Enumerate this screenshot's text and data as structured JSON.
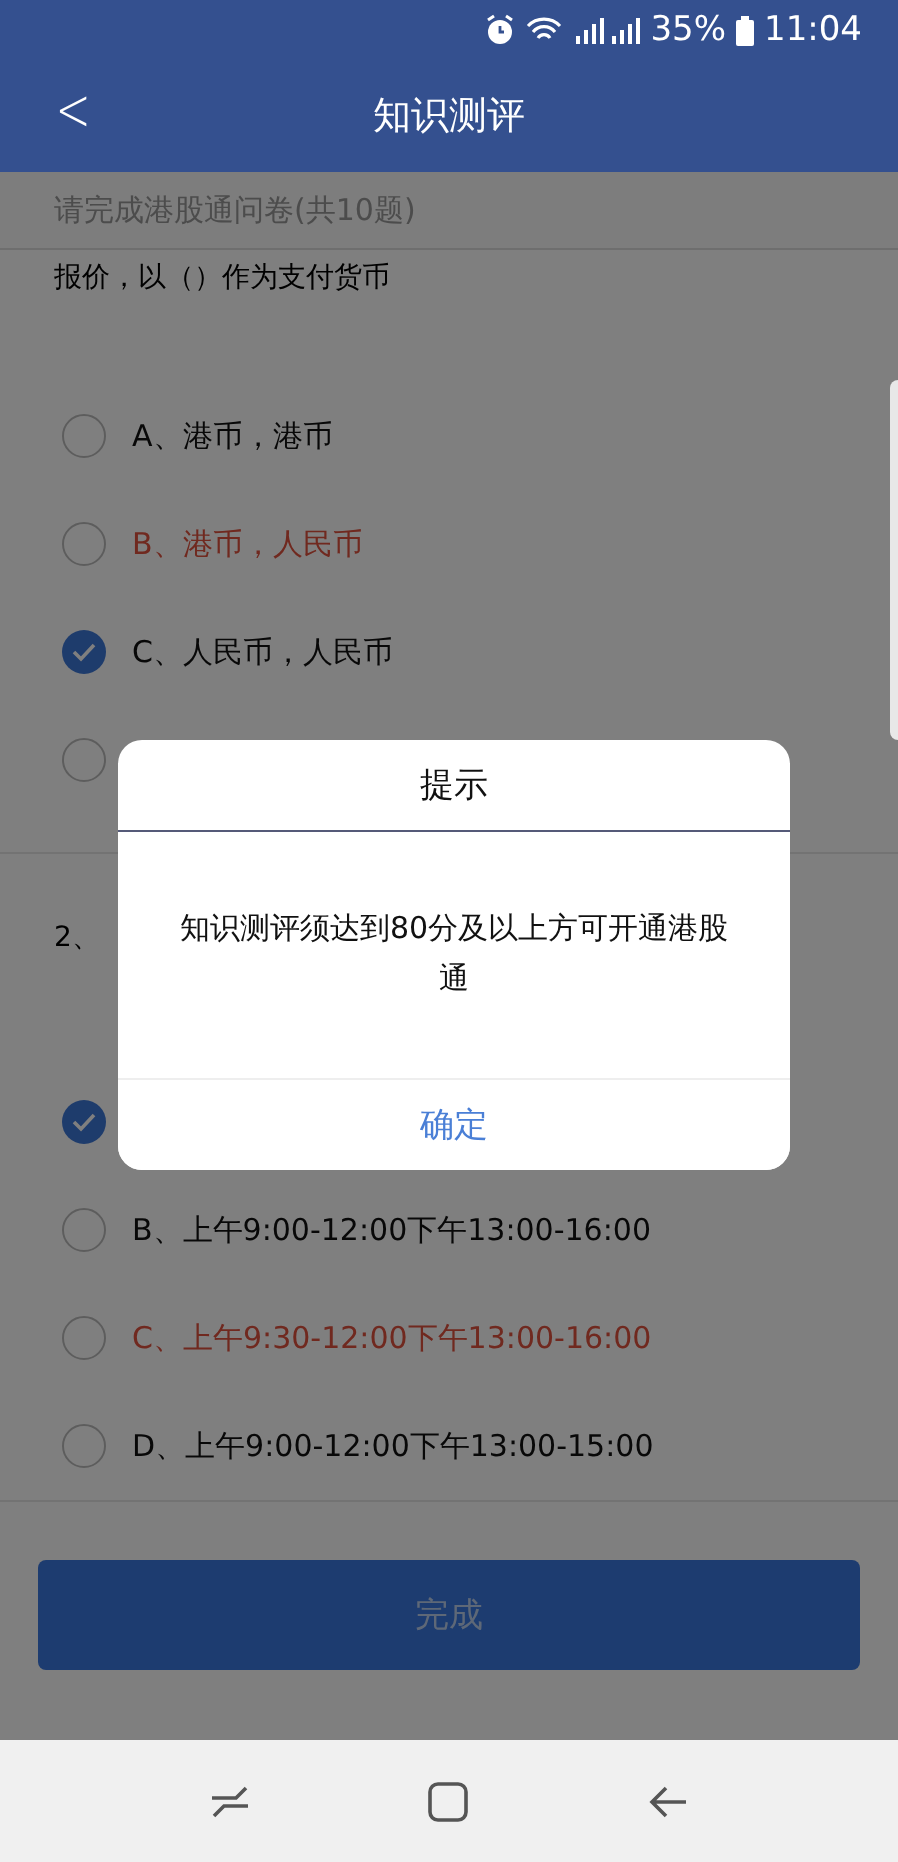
{
  "status_bar": {
    "battery": "35%",
    "time": "11:04"
  },
  "header": {
    "back": "<",
    "title": "知识测评"
  },
  "subtitle": "请完成港股通问卷(共10题)",
  "questions": [
    {
      "text": "报价，以（）作为支付货币",
      "options": [
        {
          "label": "A、港币，港币",
          "selected": false,
          "correct": false
        },
        {
          "label": "B、港币，人民币",
          "selected": false,
          "correct": true
        },
        {
          "label": "C、人民币，人民币",
          "selected": true,
          "correct": false
        },
        {
          "selected": false
        }
      ]
    },
    {
      "text": "2、",
      "options": [
        {
          "selected": true
        },
        {
          "label": "B、上午9:00-12:00下午13:00-16:00",
          "selected": false,
          "correct": false
        },
        {
          "label": "C、上午9:30-12:00下午13:00-16:00",
          "selected": false,
          "correct": true
        },
        {
          "label": "D、上午9:00-12:00下午13:00-15:00",
          "selected": false,
          "correct": false
        }
      ]
    }
  ],
  "submit_button": "完成",
  "dialog": {
    "title": "提示",
    "message": "知识测评须达到80分及以上方可开通港股通",
    "confirm": "确定"
  }
}
